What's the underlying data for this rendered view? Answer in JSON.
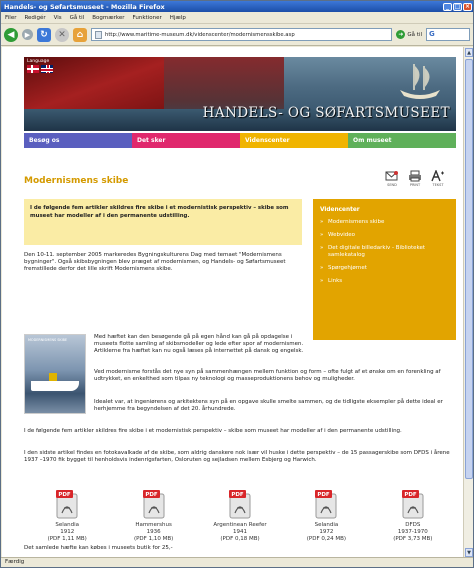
{
  "window": {
    "title": "Handels- og Søfartsmuseet - Mozilla Firefox"
  },
  "menu": [
    "Filer",
    "Redigér",
    "Vis",
    "Gå til",
    "Bogmærker",
    "Funktioner",
    "Hjælp"
  ],
  "address": {
    "url": "http://www.maritime-museum.dk/videnscenter/modernismensskibe.asp",
    "go_label": "Gå til",
    "search_value": "G"
  },
  "banner": {
    "language_label": "Language",
    "title": "HANDELS- OG SØFARTSMUSEET"
  },
  "nav": [
    "Besøg os",
    "Det sker",
    "Videnscenter",
    "Om museet"
  ],
  "page": {
    "title": "Modernismens skibe",
    "tools": [
      "SEND",
      "PRINT",
      "TEKST"
    ],
    "intro": "I de følgende fem artikler skildres fire skibe i et modernistisk perspektiv – skibe som museet har modeller af i den permanente udstilling.",
    "p1": "Den 10-11. september 2005 markeredes Bygningskulturens Dag med temaet \"Modernismens bygninger\". Også skibsbygningen blev præget af modernismen, og Handels- og Søfartsmuseet fremstillede derfor det lille skrift Modernismens skibe.",
    "p2": "Med hæftet kan den besøgende gå på egen hånd kan gå på opdagelse i museets flotte samling af skibsmodeller og lede efter spor af modernismen. Artiklerne fra hæftet kan nu også læses på internettet på dansk og engelsk.",
    "p3": "Ved modernisme forstås det nye syn på sammenhængen mellem funktion og form – ofte fulgt af et ønske om en forenkling af udtrykket, en enkelthed som tilpas ny teknologi og masseproduktionens behov og muligheder.",
    "p4": "Idealet var, at ingeniørens og arkitektens syn på en opgave skulle smelte sammen, og de tidligste eksempler på dette ideal er herhjemme fra begyndelsen af det 20. århundrede.",
    "p5": "I de følgende fem artikler skildres fire skibe i et modernistisk perspektiv – skibe som museet har modeller af i den permanente udstilling.",
    "p6": "I den sidste artikel findes en fotokavalkade af de skibe, som aldrig danskere nok især vil huske i dette perspektiv – de 15 passagerskibe som DFDS i årene 1937 –1970 fik bygget til henholdsvis indenrigsfarten, Oslo­ruten og sejladsen mellem Esbjerg og Harwich.",
    "footer": "Det samlede hæfte kan købes i museets butik for 25,-",
    "cover_text": "MODERNISMENS SKIBE"
  },
  "sidebar": {
    "title": "Videncenter",
    "items": [
      "Modernismens skibe",
      "Webvideo",
      "Det digitale billedarkiv - Biblioteket samlekatalog",
      "Spørgehjørnet",
      "Links"
    ]
  },
  "pdfs": [
    {
      "name": "Selandia",
      "year": "1912",
      "size": "(PDF 1,11 MB)"
    },
    {
      "name": "Hammershus",
      "year": "1936",
      "size": "(PDF 1,10 MB)"
    },
    {
      "name": "Argentinean Reefer",
      "year": "1941",
      "size": "(PDF 0,18 MB)"
    },
    {
      "name": "Selandia",
      "year": "1972",
      "size": "(PDF 0,24 MB)"
    },
    {
      "name": "DFDS",
      "year": "1937-1970",
      "size": "(PDF 3,73 MB)"
    }
  ],
  "pdf_badge": "PDF",
  "status": "Færdig"
}
